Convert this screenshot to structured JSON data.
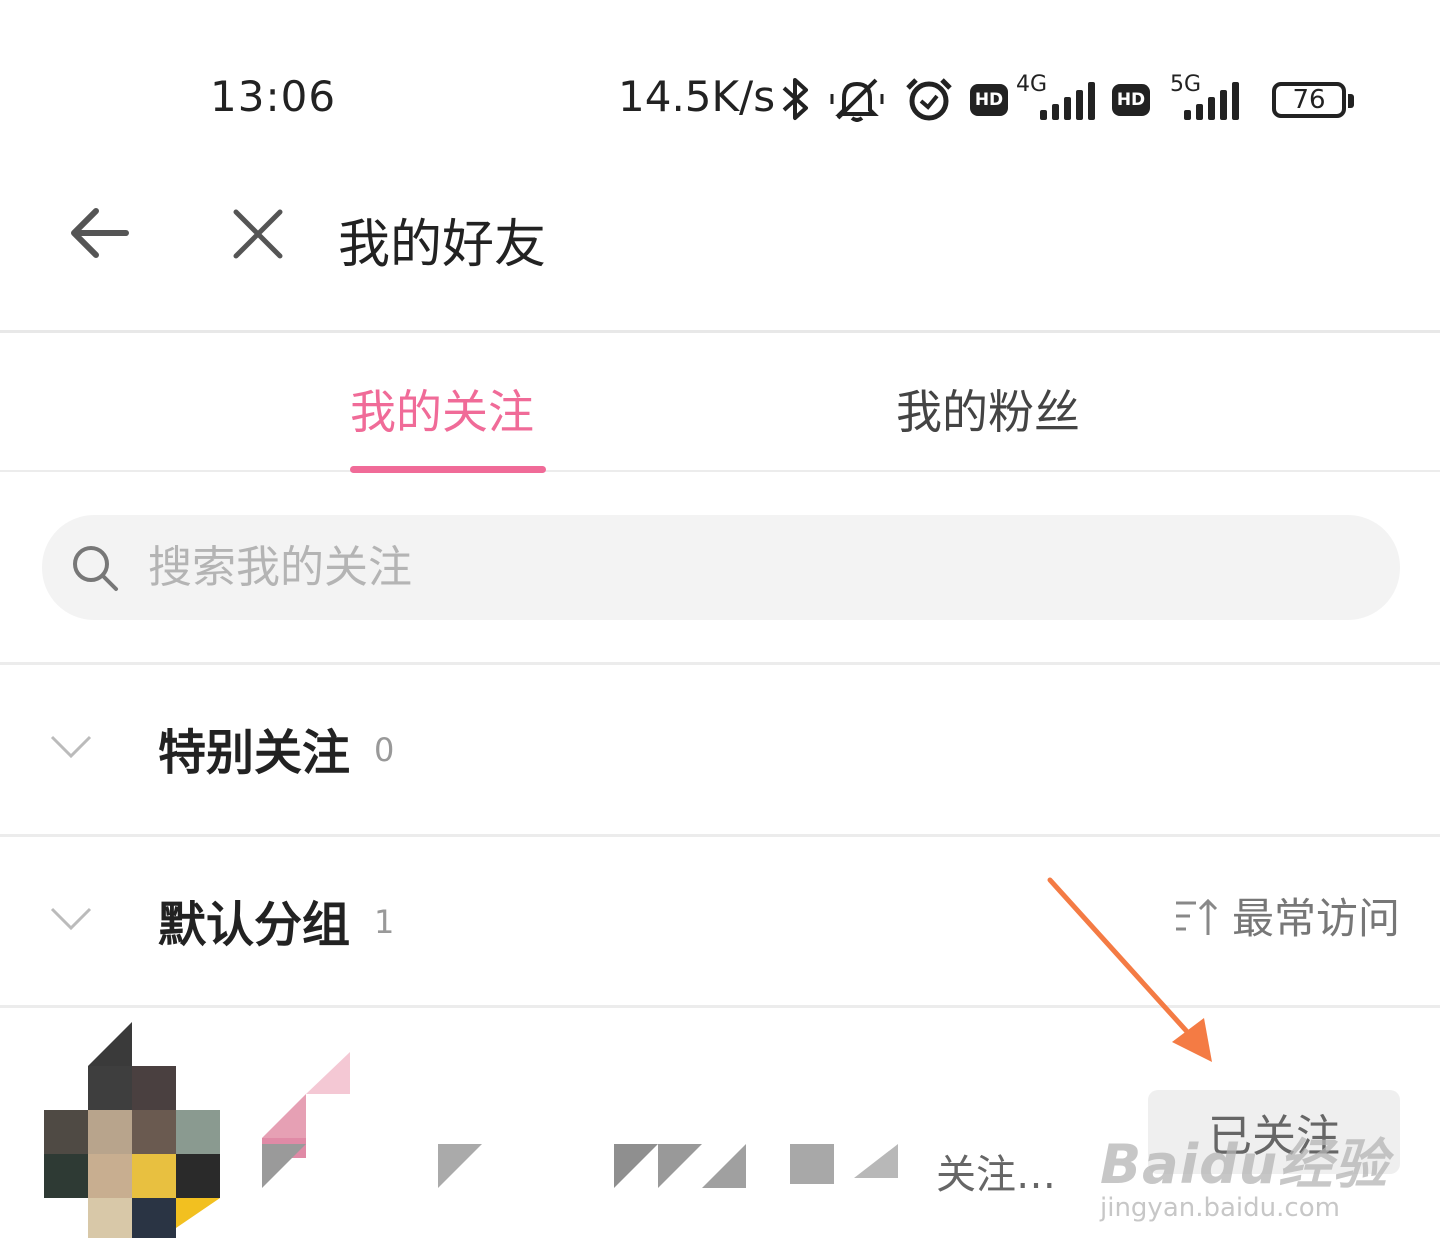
{
  "status_bar": {
    "time": "13:06",
    "net_speed": "14.5K/s",
    "hd1": "HD",
    "net1": "4G",
    "hd2": "HD",
    "net2": "5G",
    "battery": "76",
    "icons": [
      "bluetooth-icon",
      "mute-icon",
      "alarm-icon"
    ]
  },
  "header": {
    "title": "我的好友",
    "back_icon": "arrow-left-icon",
    "close_icon": "close-icon"
  },
  "tabs": [
    {
      "label": "我的关注",
      "active": true
    },
    {
      "label": "我的粉丝",
      "active": false
    }
  ],
  "colors": {
    "accent": "#f06b98",
    "arrow": "#f47b44"
  },
  "search": {
    "placeholder": "搜索我的关注",
    "value": ""
  },
  "groups": [
    {
      "name": "特别关注",
      "count": "0",
      "expanded": false
    },
    {
      "name": "默认分组",
      "count": "1",
      "expanded": false,
      "sort_label": "最常访问"
    }
  ],
  "friends": [
    {
      "desc_visible": "关注…",
      "button": "已关注"
    }
  ],
  "watermark": {
    "brand": "Baidu经验",
    "url": "jingyan.baidu.com"
  }
}
